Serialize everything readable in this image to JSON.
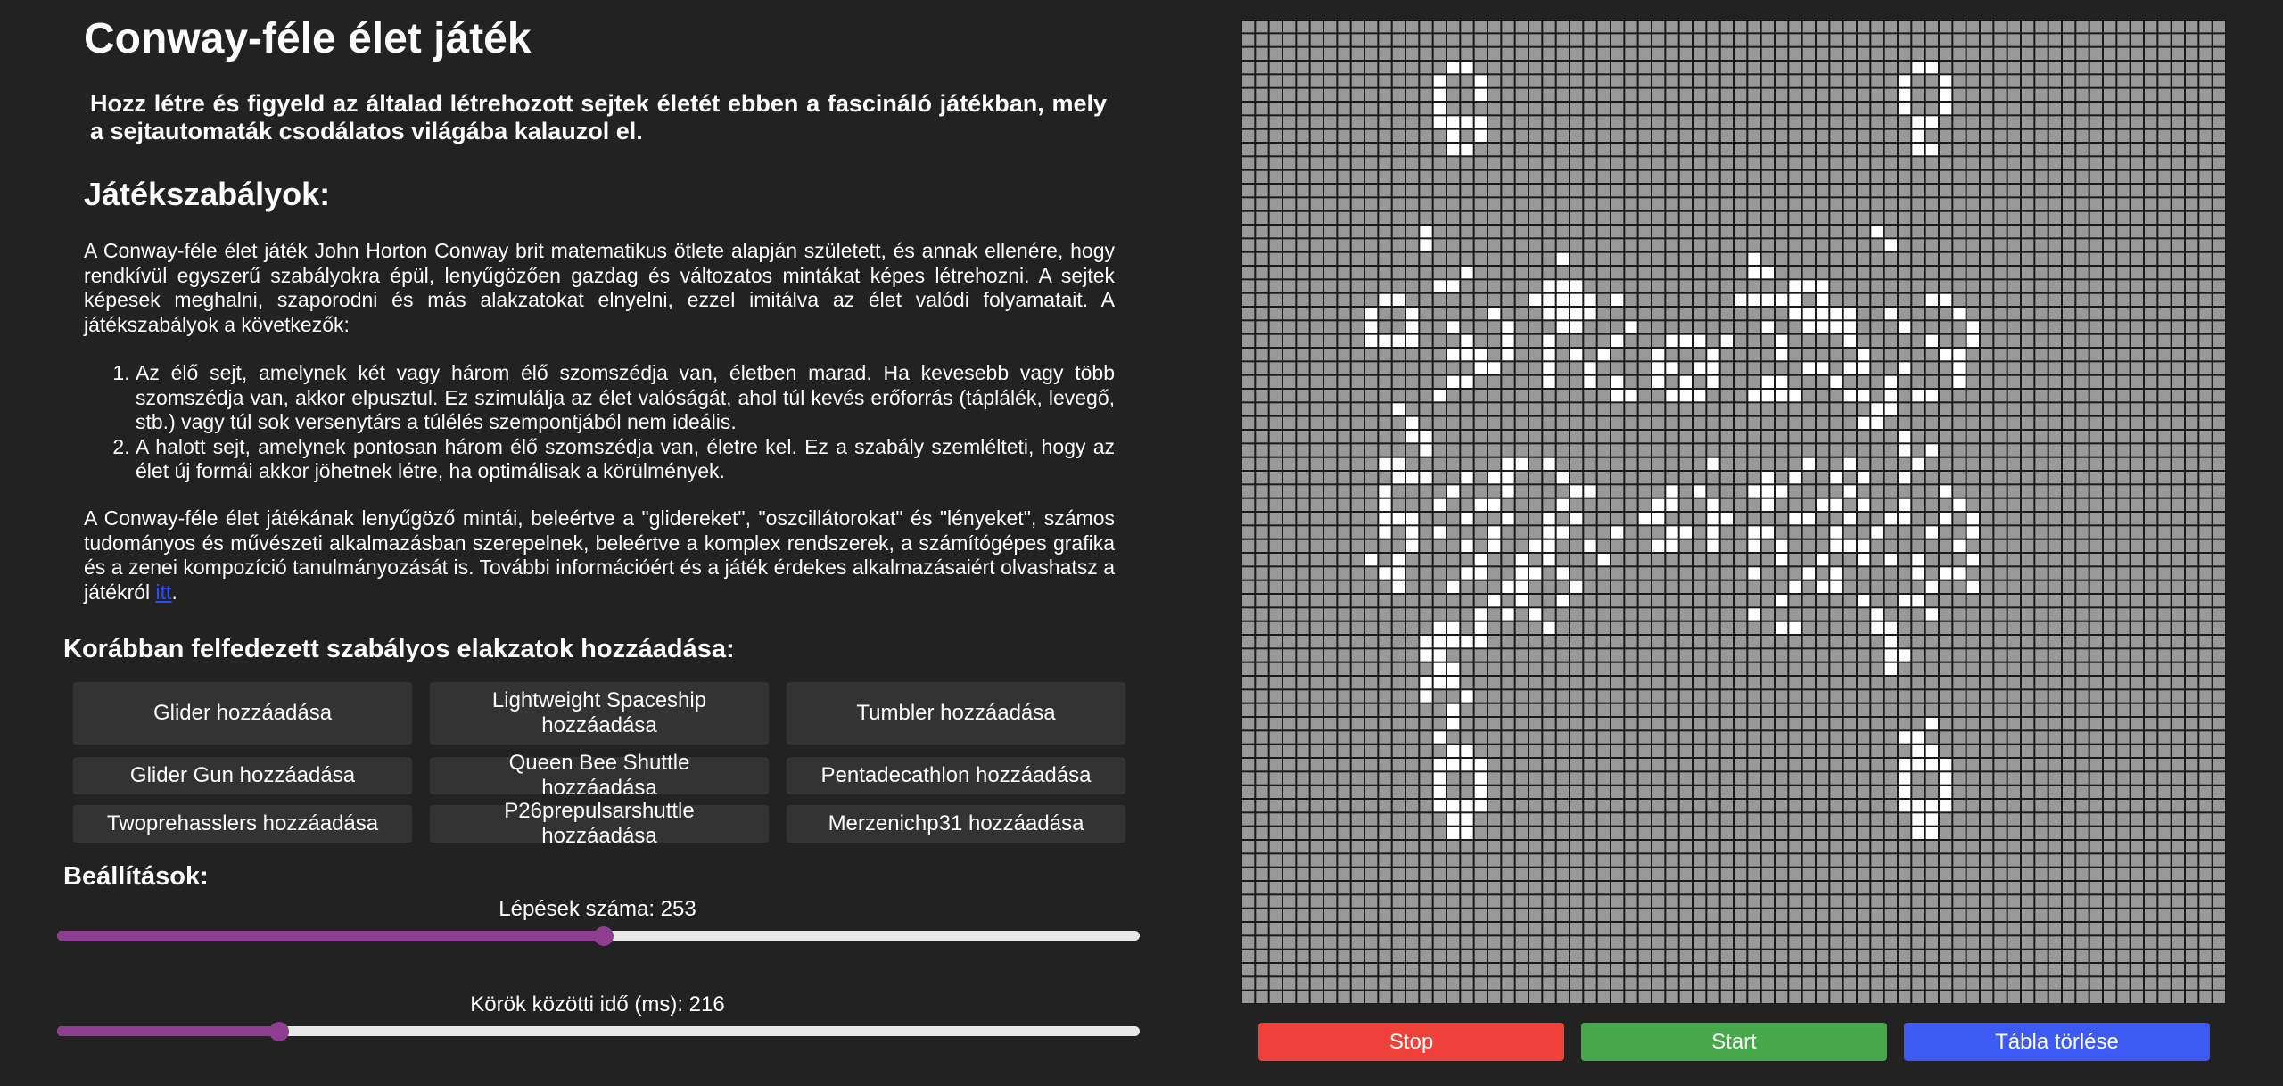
{
  "header": {
    "title": "Conway-féle élet játék",
    "intro": "Hozz létre és figyeld az általad létrehozott sejtek életét ebben a fascináló játékban, mely a sejtautomaták csodálatos világába kalauzol el."
  },
  "rules": {
    "title": "Játékszabályok:",
    "paragraph1": "A Conway-féle élet játék John Horton Conway brit matematikus ötlete alapján született, és annak ellenére, hogy rendkívül egyszerű szabályokra épül, lenyűgözően gazdag és változatos mintákat képes létrehozni. A sejtek képesek meghalni, szaporodni és más alakzatokat elnyelni, ezzel imitálva az élet valódi folyamatait. A játékszabályok a következők:",
    "items": [
      "Az élő sejt, amelynek két vagy három élő szomszédja van, életben marad. Ha kevesebb vagy több szomszédja van, akkor elpusztul. Ez szimulálja az élet valóságát, ahol túl kevés erőforrás (táplálék, levegő, stb.) vagy túl sok versenytárs a túlélés szempontjából nem ideális.",
      "A halott sejt, amelynek pontosan három élő szomszédja van, életre kel. Ez a szabály szemlélteti, hogy az élet új formái akkor jöhetnek létre, ha optimálisak a körülmények."
    ],
    "paragraph2": "A Conway-féle élet játékának lenyűgöző mintái, beleértve a \"glidereket\", \"oszcillátorokat\" és \"lényeket\", számos tudományos és művészeti alkalmazásban szerepelnek, beleértve a komplex rendszerek, a számítógépes grafika és a zenei kompozíció tanulmányozását is. További információért és a játék érdekes alkalmazásaiért olvashatsz a játékról ",
    "link_text": "itt",
    "paragraph2_end": "."
  },
  "patterns": {
    "title": "Korábban felfedezett szabályos elakzatok hozzáadása:",
    "buttons": [
      "Glider hozzáadása",
      "Lightweight Spaceship hozzáadása",
      "Tumbler hozzáadása",
      "Glider Gun hozzáadása",
      "Queen Bee Shuttle hozzáadása",
      "Pentadecathlon hozzáadása",
      "Twoprehasslers hozzáadása",
      "P26prepulsarshuttle hozzáadása",
      "Merzenichp31 hozzáadása"
    ]
  },
  "settings": {
    "title": "Beállítások:",
    "steps_label": "Lépések száma: 253",
    "steps_fraction": 0.505,
    "delay_label": "Körök közötti idő (ms): 216",
    "delay_fraction": 0.205
  },
  "controls": {
    "stop": "Stop",
    "start": "Start",
    "clear": "Tábla törlése"
  },
  "board": {
    "rows": 72,
    "cols": 72,
    "colors": {
      "dead": "#999999",
      "alive": "#ffffff",
      "grid": "#1a1a1a"
    },
    "live_cells": [
      [
        3,
        15
      ],
      [
        3,
        16
      ],
      [
        3,
        49
      ],
      [
        3,
        50
      ],
      [
        4,
        14
      ],
      [
        4,
        17
      ],
      [
        4,
        48
      ],
      [
        4,
        51
      ],
      [
        5,
        14
      ],
      [
        5,
        17
      ],
      [
        5,
        48
      ],
      [
        5,
        51
      ],
      [
        6,
        14
      ],
      [
        6,
        48
      ],
      [
        6,
        51
      ],
      [
        7,
        14
      ],
      [
        7,
        15
      ],
      [
        7,
        16
      ],
      [
        7,
        17
      ],
      [
        7,
        49
      ],
      [
        7,
        50
      ],
      [
        8,
        15
      ],
      [
        8,
        17
      ],
      [
        8,
        49
      ],
      [
        9,
        15
      ],
      [
        9,
        16
      ],
      [
        9,
        49
      ],
      [
        9,
        50
      ],
      [
        15,
        13
      ],
      [
        15,
        46
      ],
      [
        16,
        13
      ],
      [
        16,
        47
      ],
      [
        17,
        23
      ],
      [
        17,
        37
      ],
      [
        18,
        16
      ],
      [
        18,
        37
      ],
      [
        18,
        38
      ],
      [
        19,
        14
      ],
      [
        19,
        15
      ],
      [
        19,
        22
      ],
      [
        19,
        23
      ],
      [
        19,
        24
      ],
      [
        19,
        40
      ],
      [
        19,
        41
      ],
      [
        19,
        42
      ],
      [
        20,
        10
      ],
      [
        20,
        11
      ],
      [
        20,
        21
      ],
      [
        20,
        22
      ],
      [
        20,
        23
      ],
      [
        20,
        24
      ],
      [
        20,
        25
      ],
      [
        20,
        27
      ],
      [
        20,
        36
      ],
      [
        20,
        37
      ],
      [
        20,
        38
      ],
      [
        20,
        39
      ],
      [
        20,
        40
      ],
      [
        20,
        42
      ],
      [
        20,
        50
      ],
      [
        20,
        51
      ],
      [
        21,
        9
      ],
      [
        21,
        12
      ],
      [
        21,
        18
      ],
      [
        21,
        22
      ],
      [
        21,
        23
      ],
      [
        21,
        24
      ],
      [
        21,
        25
      ],
      [
        21,
        40
      ],
      [
        21,
        41
      ],
      [
        21,
        42
      ],
      [
        21,
        43
      ],
      [
        21,
        44
      ],
      [
        21,
        47
      ],
      [
        21,
        52
      ],
      [
        22,
        9
      ],
      [
        22,
        12
      ],
      [
        22,
        15
      ],
      [
        22,
        19
      ],
      [
        22,
        23
      ],
      [
        22,
        24
      ],
      [
        22,
        28
      ],
      [
        22,
        38
      ],
      [
        22,
        41
      ],
      [
        22,
        42
      ],
      [
        22,
        43
      ],
      [
        22,
        44
      ],
      [
        22,
        48
      ],
      [
        22,
        53
      ],
      [
        23,
        9
      ],
      [
        23,
        10
      ],
      [
        23,
        11
      ],
      [
        23,
        12
      ],
      [
        23,
        16
      ],
      [
        23,
        19
      ],
      [
        23,
        22
      ],
      [
        23,
        27
      ],
      [
        23,
        31
      ],
      [
        23,
        32
      ],
      [
        23,
        33
      ],
      [
        23,
        35
      ],
      [
        23,
        39
      ],
      [
        23,
        44
      ],
      [
        23,
        50
      ],
      [
        23,
        53
      ],
      [
        24,
        15
      ],
      [
        24,
        16
      ],
      [
        24,
        17
      ],
      [
        24,
        19
      ],
      [
        24,
        22
      ],
      [
        24,
        24
      ],
      [
        24,
        26
      ],
      [
        24,
        30
      ],
      [
        24,
        34
      ],
      [
        24,
        39
      ],
      [
        24,
        45
      ],
      [
        24,
        51
      ],
      [
        24,
        52
      ],
      [
        25,
        17
      ],
      [
        25,
        18
      ],
      [
        25,
        22
      ],
      [
        25,
        25
      ],
      [
        25,
        30
      ],
      [
        25,
        31
      ],
      [
        25,
        33
      ],
      [
        25,
        34
      ],
      [
        25,
        41
      ],
      [
        25,
        42
      ],
      [
        25,
        44
      ],
      [
        25,
        45
      ],
      [
        25,
        48
      ],
      [
        25,
        52
      ],
      [
        26,
        15
      ],
      [
        26,
        16
      ],
      [
        26,
        22
      ],
      [
        26,
        25
      ],
      [
        26,
        27
      ],
      [
        26,
        30
      ],
      [
        26,
        32
      ],
      [
        26,
        34
      ],
      [
        26,
        38
      ],
      [
        26,
        39
      ],
      [
        26,
        43
      ],
      [
        26,
        47
      ],
      [
        26,
        52
      ],
      [
        27,
        14
      ],
      [
        27,
        27
      ],
      [
        27,
        28
      ],
      [
        27,
        31
      ],
      [
        27,
        32
      ],
      [
        27,
        33
      ],
      [
        27,
        37
      ],
      [
        27,
        38
      ],
      [
        27,
        39
      ],
      [
        27,
        40
      ],
      [
        27,
        44
      ],
      [
        27,
        45
      ],
      [
        27,
        47
      ],
      [
        27,
        49
      ],
      [
        27,
        50
      ],
      [
        28,
        11
      ],
      [
        28,
        46
      ],
      [
        28,
        47
      ],
      [
        29,
        12
      ],
      [
        29,
        45
      ],
      [
        29,
        46
      ],
      [
        30,
        12
      ],
      [
        30,
        13
      ],
      [
        30,
        48
      ],
      [
        31,
        13
      ],
      [
        31,
        48
      ],
      [
        31,
        50
      ],
      [
        32,
        10
      ],
      [
        32,
        11
      ],
      [
        32,
        19
      ],
      [
        32,
        20
      ],
      [
        32,
        22
      ],
      [
        32,
        34
      ],
      [
        32,
        41
      ],
      [
        32,
        44
      ],
      [
        32,
        49
      ],
      [
        33,
        11
      ],
      [
        33,
        12
      ],
      [
        33,
        13
      ],
      [
        33,
        16
      ],
      [
        33,
        18
      ],
      [
        33,
        19
      ],
      [
        33,
        23
      ],
      [
        33,
        38
      ],
      [
        33,
        40
      ],
      [
        33,
        43
      ],
      [
        33,
        45
      ],
      [
        33,
        48
      ],
      [
        34,
        10
      ],
      [
        34,
        15
      ],
      [
        34,
        19
      ],
      [
        34,
        24
      ],
      [
        34,
        25
      ],
      [
        34,
        31
      ],
      [
        34,
        33
      ],
      [
        34,
        37
      ],
      [
        34,
        38
      ],
      [
        34,
        39
      ],
      [
        34,
        44
      ],
      [
        34,
        51
      ],
      [
        35,
        10
      ],
      [
        35,
        14
      ],
      [
        35,
        17
      ],
      [
        35,
        18
      ],
      [
        35,
        23
      ],
      [
        35,
        30
      ],
      [
        35,
        31
      ],
      [
        35,
        34
      ],
      [
        35,
        38
      ],
      [
        35,
        42
      ],
      [
        35,
        43
      ],
      [
        35,
        45
      ],
      [
        35,
        48
      ],
      [
        35,
        52
      ],
      [
        36,
        10
      ],
      [
        36,
        11
      ],
      [
        36,
        12
      ],
      [
        36,
        16
      ],
      [
        36,
        19
      ],
      [
        36,
        22
      ],
      [
        36,
        24
      ],
      [
        36,
        29
      ],
      [
        36,
        30
      ],
      [
        36,
        34
      ],
      [
        36,
        35
      ],
      [
        36,
        40
      ],
      [
        36,
        41
      ],
      [
        36,
        44
      ],
      [
        36,
        47
      ],
      [
        36,
        48
      ],
      [
        36,
        51
      ],
      [
        36,
        53
      ],
      [
        37,
        10
      ],
      [
        37,
        12
      ],
      [
        37,
        14
      ],
      [
        37,
        18
      ],
      [
        37,
        22
      ],
      [
        37,
        23
      ],
      [
        37,
        27
      ],
      [
        37,
        31
      ],
      [
        37,
        32
      ],
      [
        37,
        34
      ],
      [
        37,
        37
      ],
      [
        37,
        38
      ],
      [
        37,
        43
      ],
      [
        37,
        46
      ],
      [
        37,
        50
      ],
      [
        37,
        53
      ],
      [
        38,
        12
      ],
      [
        38,
        16
      ],
      [
        38,
        18
      ],
      [
        38,
        21
      ],
      [
        38,
        22
      ],
      [
        38,
        25
      ],
      [
        38,
        30
      ],
      [
        38,
        31
      ],
      [
        38,
        34
      ],
      [
        38,
        37
      ],
      [
        38,
        39
      ],
      [
        38,
        43
      ],
      [
        38,
        44
      ],
      [
        38,
        45
      ],
      [
        38,
        52
      ],
      [
        39,
        9
      ],
      [
        39,
        11
      ],
      [
        39,
        17
      ],
      [
        39,
        20
      ],
      [
        39,
        22
      ],
      [
        39,
        26
      ],
      [
        39,
        39
      ],
      [
        39,
        42
      ],
      [
        39,
        45
      ],
      [
        39,
        47
      ],
      [
        39,
        49
      ],
      [
        39,
        53
      ],
      [
        40,
        10
      ],
      [
        40,
        11
      ],
      [
        40,
        16
      ],
      [
        40,
        17
      ],
      [
        40,
        20
      ],
      [
        40,
        21
      ],
      [
        40,
        23
      ],
      [
        40,
        37
      ],
      [
        40,
        41
      ],
      [
        40,
        43
      ],
      [
        40,
        49
      ],
      [
        40,
        51
      ],
      [
        40,
        52
      ],
      [
        41,
        11
      ],
      [
        41,
        15
      ],
      [
        41,
        19
      ],
      [
        41,
        20
      ],
      [
        41,
        24
      ],
      [
        41,
        40
      ],
      [
        41,
        42
      ],
      [
        41,
        43
      ],
      [
        41,
        50
      ],
      [
        41,
        53
      ],
      [
        42,
        18
      ],
      [
        42,
        20
      ],
      [
        42,
        23
      ],
      [
        42,
        39
      ],
      [
        42,
        45
      ],
      [
        42,
        48
      ],
      [
        42,
        49
      ],
      [
        43,
        17
      ],
      [
        43,
        19
      ],
      [
        43,
        21
      ],
      [
        43,
        37
      ],
      [
        43,
        46
      ],
      [
        43,
        50
      ],
      [
        44,
        14
      ],
      [
        44,
        15
      ],
      [
        44,
        17
      ],
      [
        44,
        22
      ],
      [
        44,
        39
      ],
      [
        44,
        40
      ],
      [
        44,
        46
      ],
      [
        44,
        47
      ],
      [
        45,
        13
      ],
      [
        45,
        14
      ],
      [
        45,
        15
      ],
      [
        45,
        16
      ],
      [
        45,
        17
      ],
      [
        45,
        47
      ],
      [
        46,
        13
      ],
      [
        46,
        14
      ],
      [
        46,
        47
      ],
      [
        46,
        48
      ],
      [
        47,
        14
      ],
      [
        47,
        15
      ],
      [
        47,
        47
      ],
      [
        48,
        13
      ],
      [
        48,
        14
      ],
      [
        48,
        15
      ],
      [
        49,
        13
      ],
      [
        49,
        16
      ],
      [
        50,
        15
      ],
      [
        51,
        15
      ],
      [
        51,
        50
      ],
      [
        52,
        14
      ],
      [
        52,
        48
      ],
      [
        52,
        49
      ],
      [
        53,
        15
      ],
      [
        53,
        16
      ],
      [
        53,
        49
      ],
      [
        53,
        50
      ],
      [
        54,
        14
      ],
      [
        54,
        15
      ],
      [
        54,
        16
      ],
      [
        54,
        17
      ],
      [
        54,
        48
      ],
      [
        54,
        49
      ],
      [
        54,
        50
      ],
      [
        54,
        51
      ],
      [
        55,
        14
      ],
      [
        55,
        17
      ],
      [
        55,
        48
      ],
      [
        55,
        51
      ],
      [
        56,
        14
      ],
      [
        56,
        17
      ],
      [
        56,
        48
      ],
      [
        56,
        51
      ],
      [
        57,
        14
      ],
      [
        57,
        15
      ],
      [
        57,
        16
      ],
      [
        57,
        17
      ],
      [
        57,
        48
      ],
      [
        57,
        49
      ],
      [
        57,
        50
      ],
      [
        57,
        51
      ],
      [
        58,
        15
      ],
      [
        58,
        16
      ],
      [
        58,
        49
      ],
      [
        58,
        50
      ],
      [
        59,
        15
      ],
      [
        59,
        16
      ],
      [
        59,
        49
      ],
      [
        59,
        50
      ]
    ]
  }
}
